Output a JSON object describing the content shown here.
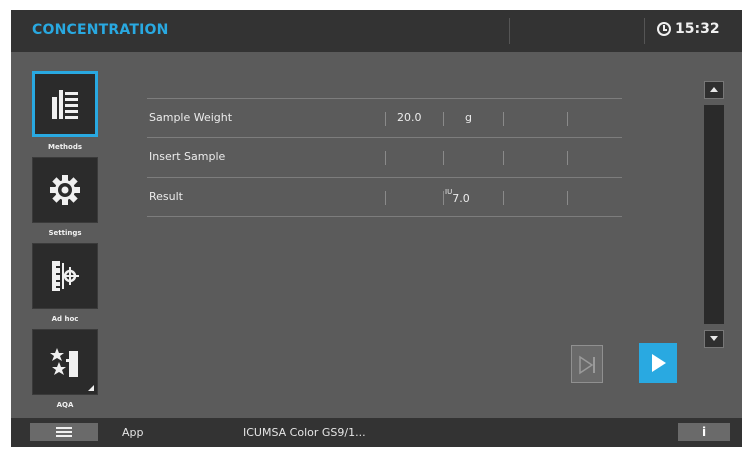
{
  "header": {
    "title": "CONCENTRATION",
    "time": "15:32",
    "clock_icon": "clock-icon"
  },
  "sidebar": {
    "items": [
      {
        "label": "Methods",
        "icon": "methods-list-icon",
        "active": true
      },
      {
        "label": "Settings",
        "icon": "gear-icon",
        "active": false
      },
      {
        "label": "Ad hoc",
        "icon": "adhoc-measure-icon",
        "active": false
      },
      {
        "label": "AQA",
        "icon": "aqa-stars-icon",
        "active": false
      }
    ]
  },
  "table": {
    "rows": [
      {
        "label": "Sample Weight",
        "value": "20.0",
        "unit": "g"
      },
      {
        "label": "Insert Sample",
        "value": "",
        "unit": ""
      },
      {
        "label": "Result",
        "value": "",
        "unit_main": "IU",
        "unit_sub": "7.0"
      }
    ]
  },
  "buttons": {
    "skip_icon": "skip-next-icon",
    "play_icon": "play-icon",
    "scroll_up_icon": "chevron-up-icon",
    "scroll_down_icon": "chevron-down-icon"
  },
  "footer": {
    "menu_icon": "hamburger-menu-icon",
    "app_label": "App",
    "method_name": "ICUMSA Color GS9/1...",
    "info_label": "i"
  },
  "colors": {
    "accent": "#29a9e1",
    "background": "#5b5b5b",
    "header": "#333333"
  }
}
